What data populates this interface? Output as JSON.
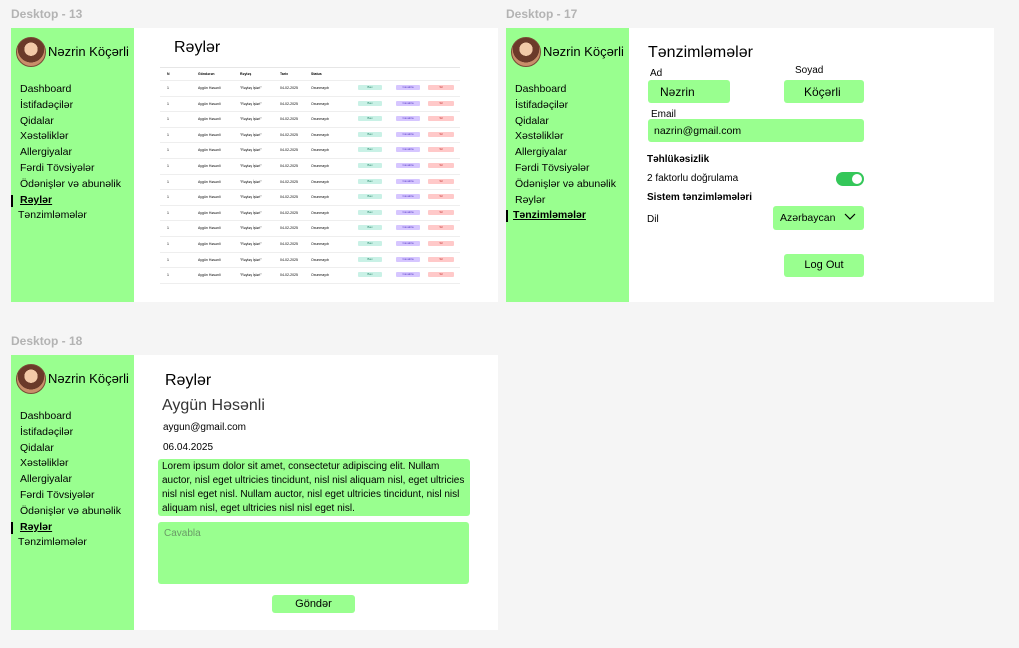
{
  "frames": {
    "d13": "Desktop - 13",
    "d17": "Desktop - 17",
    "d18": "Desktop - 18"
  },
  "user": {
    "name": "Nəzrin Köçərli"
  },
  "nav": [
    "Dashboard",
    "İstifadəçilər",
    "Qidalar",
    "Xəstəliklər",
    "Allergiyalar",
    "Fərdi Tövsiyələr",
    "Ödənişlər və abunəlik",
    "Rəylər",
    "Tənzimləmələr"
  ],
  "reviews_page": {
    "title": "Rəylər",
    "table": {
      "headers": [
        "N",
        "Göndərən",
        "Rəyləş",
        "Tarix",
        "Status"
      ],
      "rows": [
        [
          "1",
          "Aygün Həsənli",
          "\"Rəyləş İşləri\"",
          "04-02-2025",
          "Oxunmayıb",
          "Bax",
          "Cavabla",
          "Sil"
        ],
        [
          "1",
          "Aygün Həsənli",
          "\"Rəyləş İşləri\"",
          "04-02-2025",
          "Oxunmayıb",
          "Bax",
          "Cavabla",
          "Sil"
        ],
        [
          "1",
          "Aygün Həsənli",
          "\"Rəyləş İşləri\"",
          "04-02-2025",
          "Oxunmayıb",
          "Bax",
          "Cavabla",
          "Sil"
        ],
        [
          "1",
          "Aygün Həsənli",
          "\"Rəyləş İşləri\"",
          "04-02-2025",
          "Oxunmayıb",
          "Bax",
          "Cavabla",
          "Sil"
        ],
        [
          "1",
          "Aygün Həsənli",
          "\"Rəyləş İşləri\"",
          "04-02-2025",
          "Oxunmayıb",
          "Bax",
          "Cavabla",
          "Sil"
        ],
        [
          "1",
          "Aygün Həsənli",
          "\"Rəyləş İşləri\"",
          "04-02-2025",
          "Oxunmayıb",
          "Bax",
          "Cavabla",
          "Sil"
        ],
        [
          "1",
          "Aygün Həsənli",
          "\"Rəyləş İşləri\"",
          "04-02-2025",
          "Oxunmayıb",
          "Bax",
          "Cavabla",
          "Sil"
        ],
        [
          "1",
          "Aygün Həsənli",
          "\"Rəyləş İşləri\"",
          "04-02-2025",
          "Oxunmayıb",
          "Bax",
          "Cavabla",
          "Sil"
        ],
        [
          "1",
          "Aygün Həsənli",
          "\"Rəyləş İşləri\"",
          "04-02-2025",
          "Oxunmayıb",
          "Bax",
          "Cavabla",
          "Sil"
        ],
        [
          "1",
          "Aygün Həsənli",
          "\"Rəyləş İşləri\"",
          "04-02-2025",
          "Oxunmayıb",
          "Bax",
          "Cavabla",
          "Sil"
        ],
        [
          "1",
          "Aygün Həsənli",
          "\"Rəyləş İşləri\"",
          "04-02-2025",
          "Oxunmayıb",
          "Bax",
          "Cavabla",
          "Sil"
        ],
        [
          "1",
          "Aygün Həsənli",
          "\"Rəyləş İşləri\"",
          "04-02-2025",
          "Oxunmayıb",
          "Bax",
          "Cavabla",
          "Sil"
        ],
        [
          "1",
          "Aygün Həsənli",
          "\"Rəyləş İşləri\"",
          "04-02-2025",
          "Oxunmayıb",
          "Bax",
          "Cavabla",
          "Sil"
        ]
      ]
    }
  },
  "settings_page": {
    "title": "Tənzimləmələr",
    "first_name_label": "Ad",
    "first_name_value": "Nəzrin",
    "last_name_label": "Soyad",
    "last_name_value": "Köçərli",
    "email_label": "Email",
    "email_value": "nazrin@gmail.com",
    "security_heading": "Təhlükəsizlik",
    "two_factor_label": "2 faktorlu doğrulama",
    "two_factor_enabled": true,
    "system_heading": "Sistem tənzimləmələri",
    "language_label": "Dil",
    "language_value": "Azərbaycan",
    "logout_label": "Log Out"
  },
  "review_detail": {
    "title": "Rəylər",
    "sender_name": "Aygün Həsənli",
    "sender_email": "aygun@gmail.com",
    "date": "06.04.2025",
    "message": "Lorem ipsum dolor sit amet, consectetur adipiscing elit. Nullam auctor, nisl eget ultricies tincidunt, nisl nisl aliquam nisl, eget ultricies nisl nisl eget nisl. Nullam auctor, nisl eget ultricies tincidunt, nisl nisl aliquam nisl, eget ultricies nisl nisl eget nisl.",
    "reply_placeholder": "Cavabla",
    "send_label": "Göndər"
  },
  "colors": {
    "accent": "#99ff8f",
    "toggle_on": "#34c759",
    "frame_bg": "#f5f5f5"
  }
}
